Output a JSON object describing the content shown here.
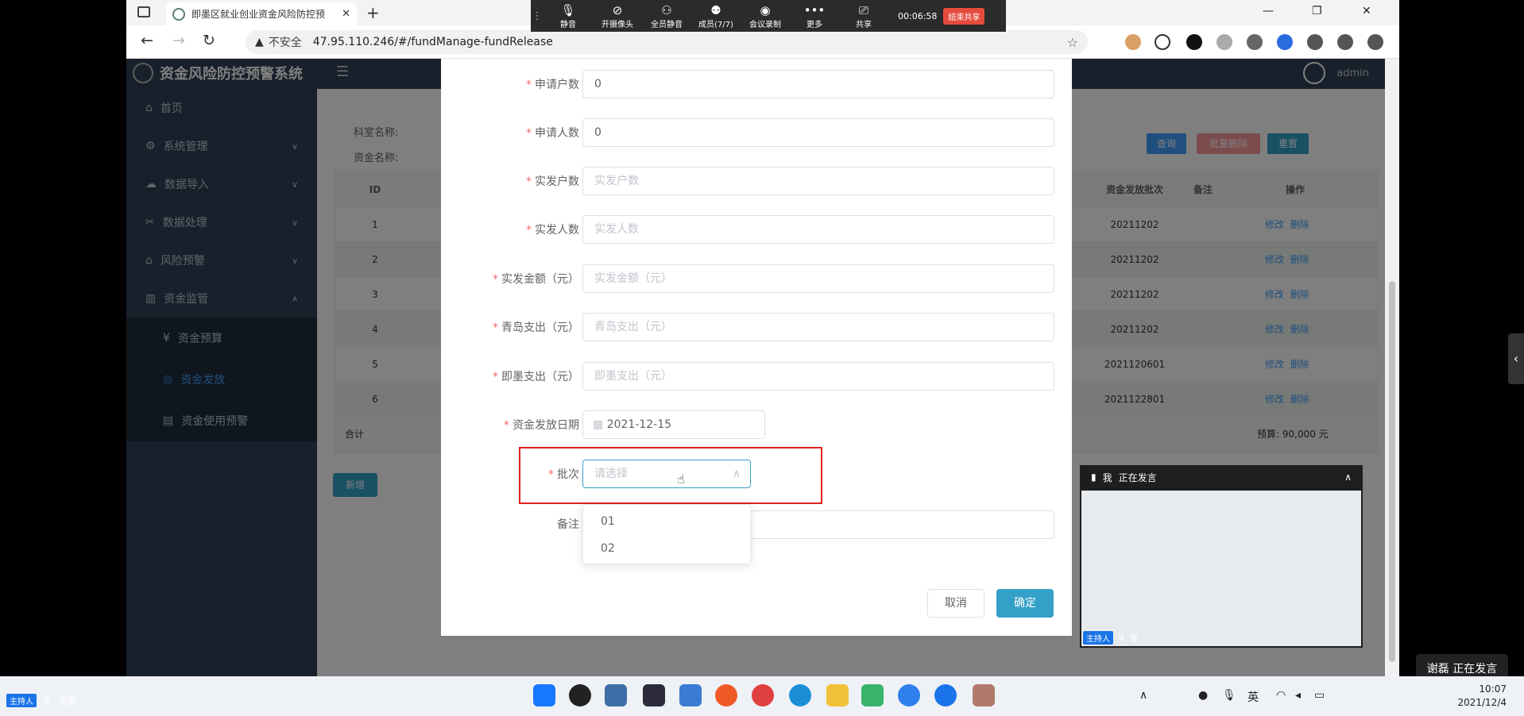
{
  "browser": {
    "tab_title": "即墨区就业创业资金风险防控预",
    "url_security": "不安全",
    "url": "47.95.110.246/#/fundManage-fundRelease"
  },
  "meeting_toolbar": {
    "buttons": [
      "静音",
      "开摄像头",
      "全员静音",
      "成员(7/7)",
      "会议录制",
      "更多",
      "共享"
    ],
    "timer": "00:06:58",
    "end_share": "结束共享"
  },
  "app": {
    "title": "资金风险防控预警系统",
    "user": "admin",
    "sidebar": [
      {
        "label": "首页"
      },
      {
        "label": "系统管理"
      },
      {
        "label": "数据导入"
      },
      {
        "label": "数据处理"
      },
      {
        "label": "风险预警"
      },
      {
        "label": "资金监管"
      },
      {
        "label": "资金预算"
      },
      {
        "label": "资金发放"
      },
      {
        "label": "资金使用预警"
      }
    ],
    "filters": {
      "dept_label": "科室名称:",
      "fund_label": "资金名称:",
      "search": "查询",
      "batch_delete": "批量删除",
      "reset": "重置"
    },
    "table": {
      "headers": {
        "id": "ID",
        "batch": "资金发放批次",
        "remark": "备注",
        "op": "操作"
      },
      "rows": [
        {
          "id": "1",
          "batch": "20211202"
        },
        {
          "id": "2",
          "batch": "20211202"
        },
        {
          "id": "3",
          "batch": "20211202"
        },
        {
          "id": "4",
          "batch": "20211202"
        },
        {
          "id": "5",
          "batch": "2021120601"
        },
        {
          "id": "6",
          "batch": "2021122801"
        }
      ],
      "edit": "修改",
      "delete": "删除",
      "total_label": "合计",
      "budget": "预算: 90,000 元"
    },
    "add_button": "新增"
  },
  "dialog": {
    "fields": [
      {
        "label": "申请户数",
        "value": "0",
        "placeholder": ""
      },
      {
        "label": "申请人数",
        "value": "0",
        "placeholder": ""
      },
      {
        "label": "实发户数",
        "value": "",
        "placeholder": "实发户数"
      },
      {
        "label": "实发人数",
        "value": "",
        "placeholder": "实发人数"
      },
      {
        "label": "实发金额（元）",
        "value": "",
        "placeholder": "实发金额（元）"
      },
      {
        "label": "青岛支出（元）",
        "value": "",
        "placeholder": "青岛支出（元）"
      },
      {
        "label": "即墨支出（元）",
        "value": "",
        "placeholder": "即墨支出（元）"
      }
    ],
    "date_label": "资金发放日期",
    "date_value": "2021-12-15",
    "batch_label": "批次",
    "batch_placeholder": "请选择",
    "batch_options": [
      "01",
      "02"
    ],
    "remark_label": "备注",
    "cancel": "取消",
    "confirm": "确定"
  },
  "self_view": {
    "name": "我",
    "status": "正在发言",
    "host_tag": "主持人",
    "me": "我"
  },
  "speaking_toast": "谢磊  正在发言",
  "host_label": {
    "tag": "主持人",
    "name": "谢磊"
  },
  "taskbar": {
    "ime": "英",
    "time": "10:07",
    "date": "2021/12/4"
  },
  "colors": {
    "accent": "#34a0c7",
    "sidebar": "#304156",
    "danger": "#e02020"
  }
}
